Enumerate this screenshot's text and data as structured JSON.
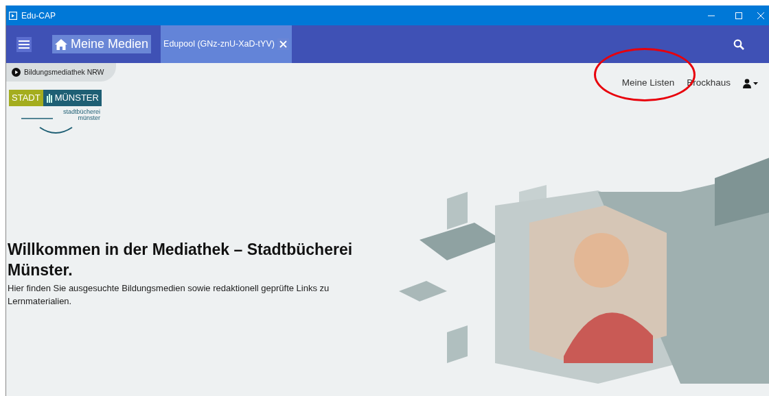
{
  "window": {
    "title": "Edu-CAP"
  },
  "tabs": [
    {
      "label": "Meine Medien",
      "kind": "home",
      "selected": false
    },
    {
      "label": "Edupool (GNz-znU-XaD-tYV)",
      "kind": "session",
      "selected": true
    }
  ],
  "source_badge": "Bildungsmediathek NRW",
  "nav_links": [
    "Meine Listen",
    "Brockhaus"
  ],
  "logo": {
    "left": "STADT",
    "right": "MÜNSTER",
    "line_1": "stadtbücherei",
    "line_2": "münster"
  },
  "hero": {
    "title": "Willkommen in der Mediathek – Stadtbücherei Münster.",
    "text": "Hier finden Sie ausgesuchte Bildungsmedien sowie redaktionell geprüfte Links zu Lernmaterialien."
  }
}
